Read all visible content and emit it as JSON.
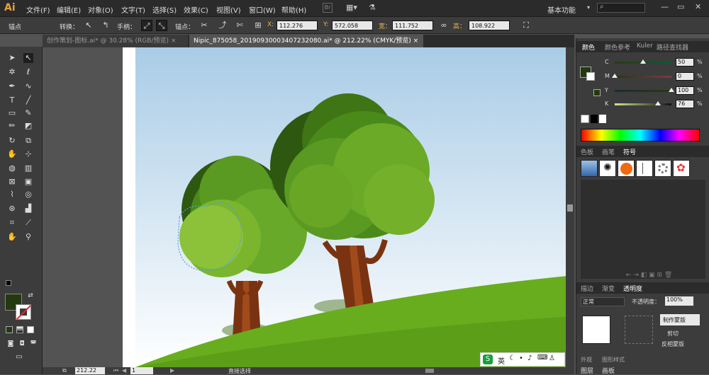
{
  "app": {
    "logo": "Ai",
    "window_controls": [
      "—",
      "▭",
      "✕"
    ]
  },
  "menu": [
    "文件(F)",
    "编辑(E)",
    "对象(O)",
    "文字(T)",
    "选择(S)",
    "效果(C)",
    "视图(V)",
    "窗口(W)",
    "帮助(H)"
  ],
  "bridge_label": "Br",
  "workspace": {
    "label": "基本功能",
    "arrow": "▾"
  },
  "control": {
    "selection_label": "锚点",
    "convert_label": "转换：",
    "handle_label": "手柄：",
    "anchor_label": "锚点：",
    "x_label": "X:",
    "x_value": "112.276",
    "y_label": "Y:",
    "y_value": "572.058",
    "w_label": "宽：",
    "w_value": "111.752",
    "h_label": "高：",
    "h_value": "108.922"
  },
  "tabs": [
    {
      "label": "创作策划-图标.ai* @ 30.28% (RGB/预览)",
      "active": false
    },
    {
      "label": "Nipic_875058_20190930003407232080.ai* @ 212.22% (CMYK/预览)",
      "active": true
    }
  ],
  "tab_close": "×",
  "tools": [
    "selection-tool",
    "direct-selection-tool",
    "magic-wand-tool",
    "lasso-tool",
    "pen-tool",
    "curvature-tool",
    "type-tool",
    "line-tool",
    "rectangle-tool",
    "paintbrush-tool",
    "pencil-tool",
    "eraser-tool",
    "rotate-tool",
    "scale-tool",
    "warp-tool",
    "free-transform-tool",
    "shape-builder-tool",
    "perspective-tool",
    "mesh-tool",
    "gradient-tool",
    "eyedropper-tool",
    "blend-tool",
    "symbol-sprayer-tool",
    "graph-tool",
    "artboard-tool",
    "slice-tool",
    "hand-tool",
    "zoom-tool"
  ],
  "colors": {
    "fill": "#233a11",
    "sky_top": "#a9cce6",
    "grass": "#68ad1e",
    "accent": "#e3b45d"
  },
  "status": {
    "zoom": "212.22",
    "page": "1",
    "tool_name": "直接选择"
  },
  "color_panel": {
    "tabs": [
      "颜色",
      "颜色参考",
      "Kuler",
      "路径查找器"
    ],
    "channels": [
      {
        "ch": "C",
        "value": "50",
        "grad": "linear-gradient(to right,#2d3a0e,#0a5a3a)"
      },
      {
        "ch": "M",
        "value": "0",
        "grad": "linear-gradient(to right,#233a11,#7a3a45)"
      },
      {
        "ch": "Y",
        "value": "100",
        "grad": "linear-gradient(to right,#1a2a3a,#2a3a12)"
      },
      {
        "ch": "K",
        "value": "76",
        "grad": "linear-gradient(to right,#cfe98a,#111)"
      }
    ],
    "pct": "%"
  },
  "symbol_panel": {
    "tabs": [
      "色板",
      "画笔",
      "符号"
    ]
  },
  "transparency_panel": {
    "tabs": [
      "描边",
      "渐变",
      "透明度"
    ],
    "blend_mode": "正常",
    "opacity_label": "不透明度：",
    "opacity_value": "100%",
    "mask_button": "制作蒙版",
    "clip_label": "剪切",
    "invert_label": "反相蒙版"
  },
  "bottom_tabs": [
    "外观",
    "图形样式",
    "图层",
    "画板"
  ],
  "ime": {
    "logo": "S",
    "lang": "英"
  }
}
